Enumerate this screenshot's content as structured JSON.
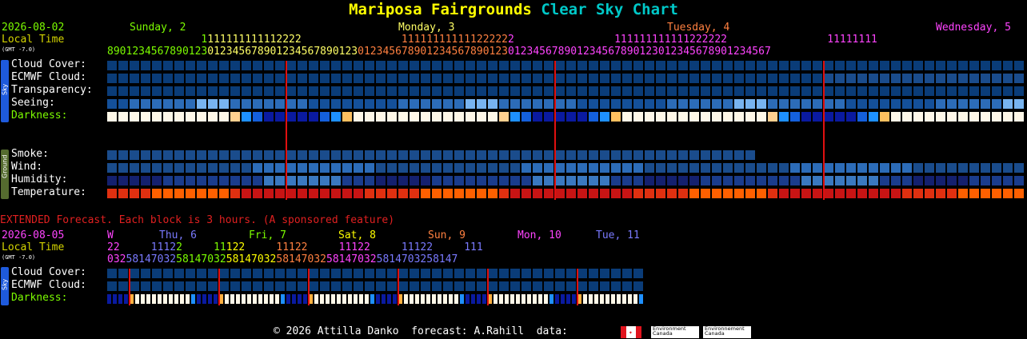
{
  "title": {
    "location": "Mariposa Fairgrounds",
    "chart_name": "Clear Sky Chart"
  },
  "colors": {
    "location": "#ffff00",
    "chart_name": "#00c8c8",
    "day1": "#7cfc00",
    "day2": "#ffff66",
    "day3": "#ff8040",
    "day4": "#ff44ff"
  },
  "header": {
    "date": "2026-08-02",
    "local_time": "Local Time",
    "gmt": "(GMT -7.0)",
    "days": [
      "Sunday, 2",
      "Monday, 3",
      "Tuesday, 4",
      "Wednesday, 5"
    ],
    "hours_tens": "               1111111111112222                111111111111222222                111111111111222222                11111111",
    "hours_ones": "8901234567890123012345678901234567890123012345678901234567890123012345678901234567890123012345678901234567"
  },
  "sky_tab": "Sky",
  "ground_tab": "Ground",
  "rows": {
    "cloud_cover": "Cloud Cover:",
    "ecmwf_cloud": "ECMWF Cloud:",
    "transparency": "Transparency:",
    "seeing": "Seeing:",
    "darkness": "Darkness:",
    "smoke": "Smoke:",
    "wind": "Wind:",
    "humidity": "Humidity:",
    "temperature": "Temperature:"
  },
  "extended": {
    "banner": "EXTENDED Forecast. Each block is 3 hours. (A sponsored feature)",
    "date": "2026-08-05",
    "local_time": "Local Time",
    "gmt": "(GMT -7.0)",
    "days": [
      "W",
      "Thu, 6",
      "Fri, 7",
      "Sat, 8",
      "Sun, 9",
      "Mon, 10",
      "Tue, 11"
    ],
    "hours_tens": "22     11122     11122     11122     11122     11122     111",
    "hours_ones": "03258147032581470325814703258147032581470325814703258147",
    "rows": {
      "cloud_cover": "Cloud Cover:",
      "ecmwf_cloud": "ECMWF Cloud:",
      "darkness": "Darkness:"
    }
  },
  "footer": {
    "copyright": "© 2026 Attilla Danko  forecast: A.Rahill  data:",
    "env_en": "Environment\nCanada",
    "env_fr": "Environnement\nCanada"
  }
}
